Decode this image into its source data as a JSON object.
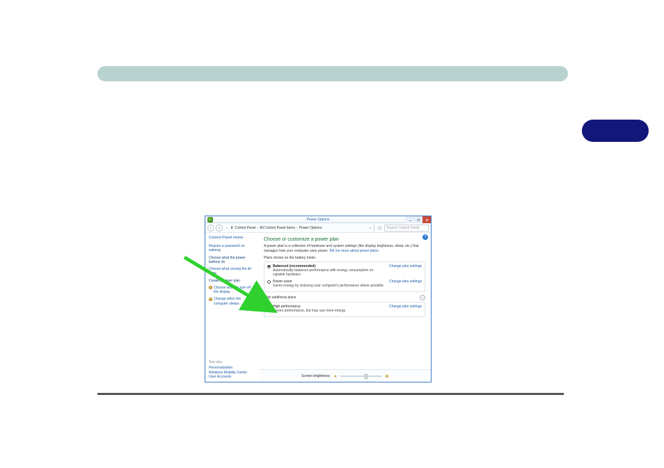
{
  "window": {
    "title": "Power Options",
    "breadcrumb": [
      "Control Panel",
      "All Control Panel Items",
      "Power Options"
    ],
    "search_placeholder": "Search Control Panel"
  },
  "sidebar": {
    "home": "Control Panel Home",
    "links": [
      "Require a password on wakeup",
      "Choose what the power buttons do",
      "Choose what closing the lid does",
      "Create a power plan",
      "Choose when to turn off the display",
      "Change when the computer sleeps"
    ],
    "seealso_heading": "See also",
    "seealso": [
      "Personalization",
      "Windows Mobility Center",
      "User Accounts"
    ]
  },
  "main": {
    "heading": "Choose or customize a power plan",
    "desc_a": "A power plan is a collection of hardware and system settings (like display brightness, sleep, etc.) that manages how your computer uses power. ",
    "desc_link": "Tell me more about power plans",
    "battery_label": "Plans shown on the battery meter",
    "hide_label": "Hide additional plans",
    "change_link": "Change plan settings",
    "plans": [
      {
        "name": "Balanced (recommended)",
        "sub": "Automatically balances performance with energy consumption on capable hardware.",
        "selected": true
      },
      {
        "name": "Power saver",
        "sub": "Saves energy by reducing your computer's performance where possible.",
        "selected": false
      }
    ],
    "extra_plan": {
      "name": "High performance",
      "sub": "Favors performance, but may use more energy.",
      "selected": false
    },
    "brightness_label": "Screen brightness:"
  }
}
